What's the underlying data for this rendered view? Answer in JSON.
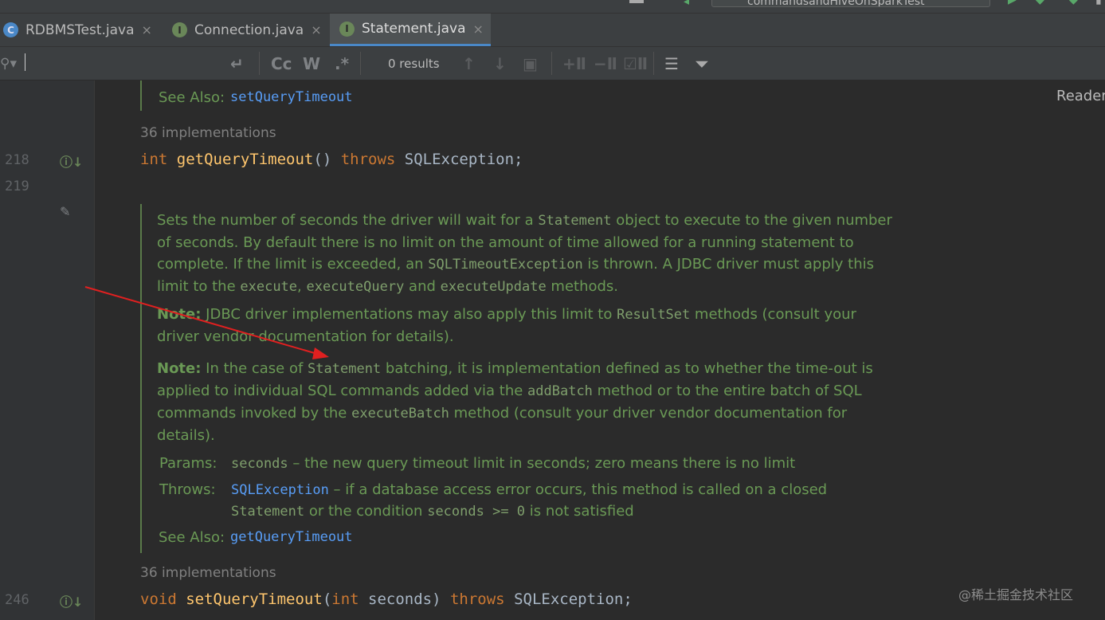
{
  "toolbar": {
    "run_config": "commandsandHiveOnSparkTest"
  },
  "tabs": [
    {
      "label": "RDBMSTest.java",
      "icon": "C",
      "icon_color": "#4a88c7",
      "close": "×"
    },
    {
      "label": "Connection.java",
      "icon": "I",
      "icon_color": "#6a8759",
      "close": "×"
    },
    {
      "label": "Statement.java",
      "icon": "I",
      "icon_color": "#6a8759",
      "close": "×"
    }
  ],
  "search": {
    "results": "0 results",
    "case_label": "Cc",
    "word_label": "W",
    "regex_label": ".*"
  },
  "editor": {
    "reader_mode": "Reader",
    "top_see_also_label": "See Also:",
    "top_see_also_link": "setQueryTimeout",
    "impl1": "36 implementations",
    "line218": "218",
    "line219": "219",
    "line246": "246",
    "code1": {
      "kw_int": "int",
      "name": "getQueryTimeout",
      "parens": "() ",
      "throws": "throws",
      "rest": " SQLException;"
    },
    "doc": {
      "p1_a": "Sets the number of seconds the driver will wait for a ",
      "p1_code1": "Statement",
      "p1_b": " object to execute to the given number of seconds. By default there is no limit on the amount of time allowed for a running statement to complete. If the limit is exceeded, an ",
      "p1_code2": "SQLTimeoutException",
      "p1_c": " is thrown. A JDBC driver must apply this limit to the ",
      "p1_code3": "execute",
      "p1_d": ", ",
      "p1_code4": "executeQuery",
      "p1_e": " and ",
      "p1_code5": "executeUpdate",
      "p1_f": " methods.",
      "p2_bold": "Note:",
      "p2_a": " JDBC driver implementations may also apply this limit to ",
      "p2_code": "ResultSet",
      "p2_b": " methods (consult your driver vendor documentation for details).",
      "p3_bold": "Note:",
      "p3_a": " In the case of ",
      "p3_code1": "Statement",
      "p3_b": " batching, it is implementation defined as to whether the time-out is applied to individual SQL commands added via the ",
      "p3_code2": "addBatch",
      "p3_c": " method or to the entire batch of SQL commands invoked by the ",
      "p3_code3": "executeBatch",
      "p3_d": " method (consult your driver vendor documentation for details).",
      "params_label": "Params:",
      "params_code": "seconds",
      "params_text": " – the new query timeout limit in seconds; zero means there is no limit",
      "throws_label": "Throws:",
      "throws_link": "SQLException",
      "throws_text1": " – if a database access error occurs, this method is called on a closed",
      "throws_code1": "Statement",
      "throws_text2": " or the condition ",
      "throws_code2": "seconds >= 0",
      "throws_text3": " is not satisfied",
      "see_also_label": "See Also:",
      "see_also_link": "getQueryTimeout"
    },
    "impl2": "36 implementations",
    "code2": {
      "kw_void": "void",
      "name": "setQueryTimeout",
      "open": "(",
      "kw_int": "int",
      "param": " seconds) ",
      "throws": "throws",
      "rest": " SQLException;"
    }
  },
  "watermark": "@稀土掘金技术社区",
  "colors": {
    "background": "#2b2b2b",
    "gutter": "#313335",
    "keyword": "#cc7832",
    "method": "#ffc66d",
    "doc_text": "#6a9955",
    "link": "#589df6",
    "annotation_arrow": "#e02020"
  }
}
